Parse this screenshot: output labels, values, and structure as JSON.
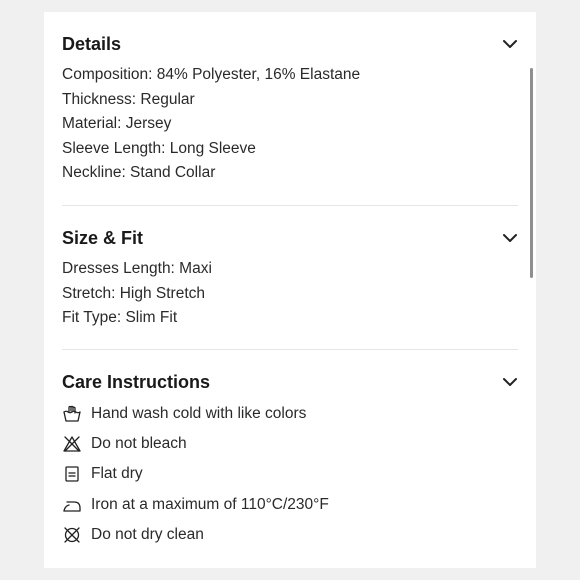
{
  "details": {
    "title": "Details",
    "lines": [
      "Composition: 84% Polyester, 16% Elastane",
      "Thickness: Regular",
      "Material: Jersey",
      "Sleeve Length: Long Sleeve",
      "Neckline: Stand Collar"
    ]
  },
  "size_fit": {
    "title": "Size & Fit",
    "lines": [
      "Dresses Length: Maxi",
      "Stretch: High Stretch",
      "Fit Type: Slim Fit"
    ]
  },
  "care": {
    "title": "Care Instructions",
    "items": [
      {
        "icon": "hand-wash-icon",
        "text": "Hand wash cold with like colors"
      },
      {
        "icon": "do-not-bleach-icon",
        "text": "Do not bleach"
      },
      {
        "icon": "flat-dry-icon",
        "text": "Flat dry"
      },
      {
        "icon": "iron-icon",
        "text": "Iron at a maximum of 110°C/230°F"
      },
      {
        "icon": "do-not-dry-clean-icon",
        "text": "Do not dry clean"
      }
    ]
  }
}
